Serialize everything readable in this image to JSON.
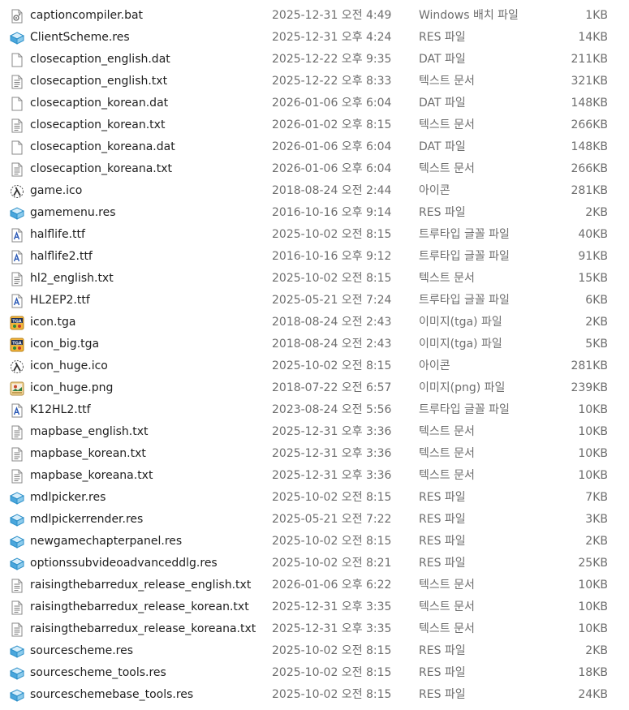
{
  "files": [
    {
      "name": "captioncompiler.bat",
      "date": "2025-12-31 오전 4:49",
      "type": "Windows 배치 파일",
      "size": "1KB",
      "icon": "batch-file-icon"
    },
    {
      "name": "ClientScheme.res",
      "date": "2025-12-31 오후 4:24",
      "type": "RES 파일",
      "size": "14KB",
      "icon": "res-file-icon"
    },
    {
      "name": "closecaption_english.dat",
      "date": "2025-12-22 오후 9:35",
      "type": "DAT 파일",
      "size": "211KB",
      "icon": "blank-file-icon"
    },
    {
      "name": "closecaption_english.txt",
      "date": "2025-12-22 오후 8:33",
      "type": "텍스트 문서",
      "size": "321KB",
      "icon": "text-file-icon"
    },
    {
      "name": "closecaption_korean.dat",
      "date": "2026-01-06 오후 6:04",
      "type": "DAT 파일",
      "size": "148KB",
      "icon": "blank-file-icon"
    },
    {
      "name": "closecaption_korean.txt",
      "date": "2026-01-02 오후 8:15",
      "type": "텍스트 문서",
      "size": "266KB",
      "icon": "text-file-icon"
    },
    {
      "name": "closecaption_koreana.dat",
      "date": "2026-01-06 오후 6:04",
      "type": "DAT 파일",
      "size": "148KB",
      "icon": "blank-file-icon"
    },
    {
      "name": "closecaption_koreana.txt",
      "date": "2026-01-06 오후 6:04",
      "type": "텍스트 문서",
      "size": "266KB",
      "icon": "text-file-icon"
    },
    {
      "name": "game.ico",
      "date": "2018-08-24 오전 2:44",
      "type": "아이콘",
      "size": "281KB",
      "icon": "lambda-ico-icon"
    },
    {
      "name": "gamemenu.res",
      "date": "2016-10-16 오후 9:14",
      "type": "RES 파일",
      "size": "2KB",
      "icon": "res-file-icon"
    },
    {
      "name": "halflife.ttf",
      "date": "2025-10-02 오전 8:15",
      "type": "트루타입 글꼴 파일",
      "size": "40KB",
      "icon": "font-file-icon"
    },
    {
      "name": "halflife2.ttf",
      "date": "2016-10-16 오후 9:12",
      "type": "트루타입 글꼴 파일",
      "size": "91KB",
      "icon": "font-file-icon"
    },
    {
      "name": "hl2_english.txt",
      "date": "2025-10-02 오전 8:15",
      "type": "텍스트 문서",
      "size": "15KB",
      "icon": "text-file-icon"
    },
    {
      "name": "HL2EP2.ttf",
      "date": "2025-05-21 오전 7:24",
      "type": "트루타입 글꼴 파일",
      "size": "6KB",
      "icon": "font-file-icon"
    },
    {
      "name": "icon.tga",
      "date": "2018-08-24 오전 2:43",
      "type": "이미지(tga) 파일",
      "size": "2KB",
      "icon": "tga-file-icon"
    },
    {
      "name": "icon_big.tga",
      "date": "2018-08-24 오전 2:43",
      "type": "이미지(tga) 파일",
      "size": "5KB",
      "icon": "tga-file-icon"
    },
    {
      "name": "icon_huge.ico",
      "date": "2025-10-02 오전 8:15",
      "type": "아이콘",
      "size": "281KB",
      "icon": "lambda-ico-icon"
    },
    {
      "name": "icon_huge.png",
      "date": "2018-07-22 오전 6:57",
      "type": "이미지(png) 파일",
      "size": "239KB",
      "icon": "png-file-icon"
    },
    {
      "name": "K12HL2.ttf",
      "date": "2023-08-24 오전 5:56",
      "type": "트루타입 글꼴 파일",
      "size": "10KB",
      "icon": "font-file-icon"
    },
    {
      "name": "mapbase_english.txt",
      "date": "2025-12-31 오후 3:36",
      "type": "텍스트 문서",
      "size": "10KB",
      "icon": "text-file-icon"
    },
    {
      "name": "mapbase_korean.txt",
      "date": "2025-12-31 오후 3:36",
      "type": "텍스트 문서",
      "size": "10KB",
      "icon": "text-file-icon"
    },
    {
      "name": "mapbase_koreana.txt",
      "date": "2025-12-31 오후 3:36",
      "type": "텍스트 문서",
      "size": "10KB",
      "icon": "text-file-icon"
    },
    {
      "name": "mdlpicker.res",
      "date": "2025-10-02 오전 8:15",
      "type": "RES 파일",
      "size": "7KB",
      "icon": "res-file-icon"
    },
    {
      "name": "mdlpickerrender.res",
      "date": "2025-05-21 오전 7:22",
      "type": "RES 파일",
      "size": "3KB",
      "icon": "res-file-icon"
    },
    {
      "name": "newgamechapterpanel.res",
      "date": "2025-10-02 오전 8:15",
      "type": "RES 파일",
      "size": "2KB",
      "icon": "res-file-icon"
    },
    {
      "name": "optionssubvideoadvanceddlg.res",
      "date": "2025-10-02 오전 8:21",
      "type": "RES 파일",
      "size": "25KB",
      "icon": "res-file-icon"
    },
    {
      "name": "raisingthebarredux_release_english.txt",
      "date": "2026-01-06 오후 6:22",
      "type": "텍스트 문서",
      "size": "10KB",
      "icon": "text-file-icon"
    },
    {
      "name": "raisingthebarredux_release_korean.txt",
      "date": "2025-12-31 오후 3:35",
      "type": "텍스트 문서",
      "size": "10KB",
      "icon": "text-file-icon"
    },
    {
      "name": "raisingthebarredux_release_koreana.txt",
      "date": "2025-12-31 오후 3:35",
      "type": "텍스트 문서",
      "size": "10KB",
      "icon": "text-file-icon"
    },
    {
      "name": "sourcescheme.res",
      "date": "2025-10-02 오전 8:15",
      "type": "RES 파일",
      "size": "2KB",
      "icon": "res-file-icon"
    },
    {
      "name": "sourcescheme_tools.res",
      "date": "2025-10-02 오전 8:15",
      "type": "RES 파일",
      "size": "18KB",
      "icon": "res-file-icon"
    },
    {
      "name": "sourceschemebase_tools.res",
      "date": "2025-10-02 오전 8:15",
      "type": "RES 파일",
      "size": "24KB",
      "icon": "res-file-icon"
    }
  ]
}
